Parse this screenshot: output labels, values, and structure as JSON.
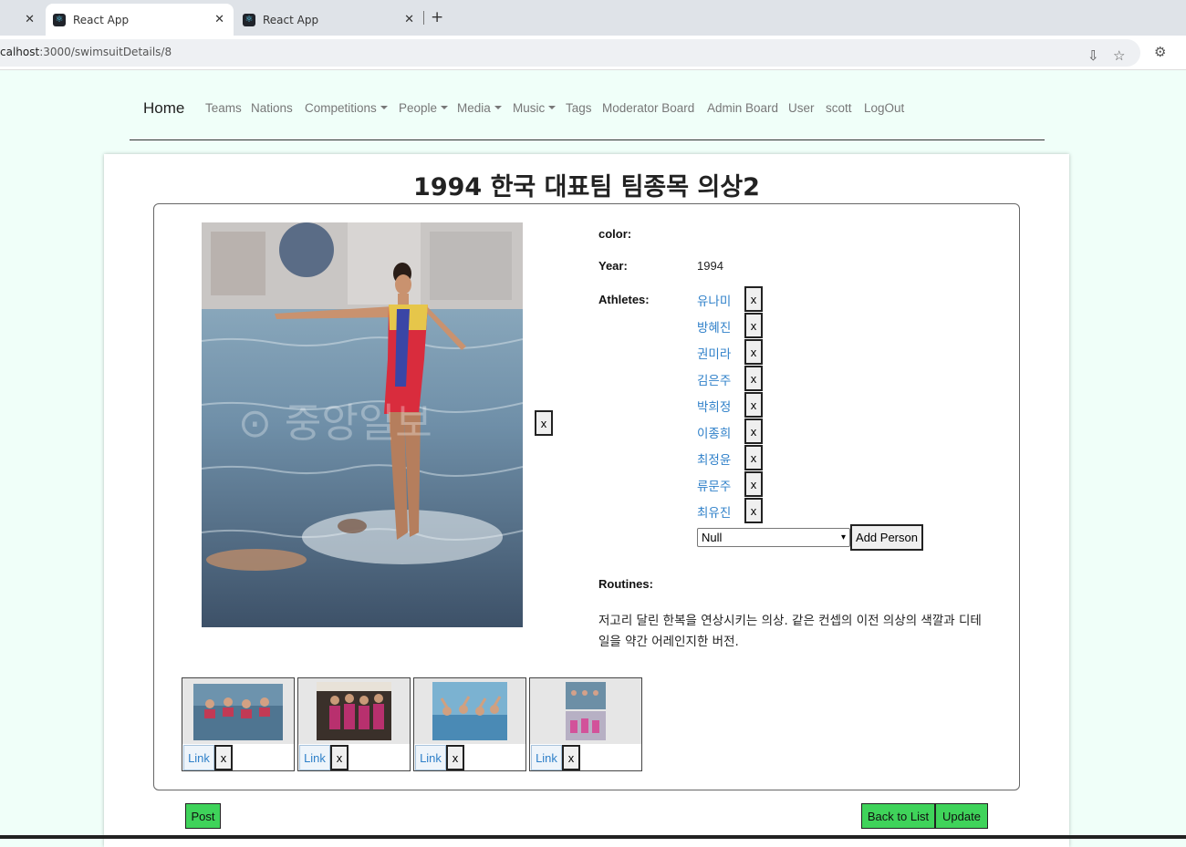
{
  "browser": {
    "tabs": [
      {
        "label": "React App"
      },
      {
        "label": "React App"
      }
    ],
    "url_host": "calhost",
    "url_path": ":3000/swimsuitDetails/8"
  },
  "nav": {
    "brand": "Home",
    "items": [
      "Teams",
      "Nations",
      "Competitions",
      "People",
      "Media",
      "Music",
      "Tags",
      "Moderator Board",
      "Admin Board",
      "User",
      "scott",
      "LogOut"
    ]
  },
  "page": {
    "title": "1994 한국 대표팀 팀종목 의상2",
    "image_remove": "x",
    "color_label": "color:",
    "color_value": "",
    "year_label": "Year:",
    "year_value": "1994",
    "athletes_label": "Athletes:",
    "athletes": [
      "유나미",
      "방혜진",
      "권미라",
      "김은주",
      "박희정",
      "이종희",
      "최정윤",
      "류문주",
      "최유진"
    ],
    "remove_label": "x",
    "person_select_value": "Null",
    "add_person_label": "Add Person",
    "routines_label": "Routines:",
    "description": "저고리 달린 한복을 연상시키는 의상. 같은 컨셉의 이전 의상의 색깔과 디테일을 약간 어레인지한 버전.",
    "thumbnails": [
      {
        "link": "Link",
        "remove": "x"
      },
      {
        "link": "Link",
        "remove": "x"
      },
      {
        "link": "Link",
        "remove": "x"
      },
      {
        "link": "Link",
        "remove": "x"
      }
    ],
    "post_label": "Post",
    "back_label": "Back to List",
    "update_label": "Update"
  },
  "colors": {
    "accent_green": "#3fd35a",
    "link_blue": "#2f80c9",
    "page_bg": "#f0fff9"
  }
}
